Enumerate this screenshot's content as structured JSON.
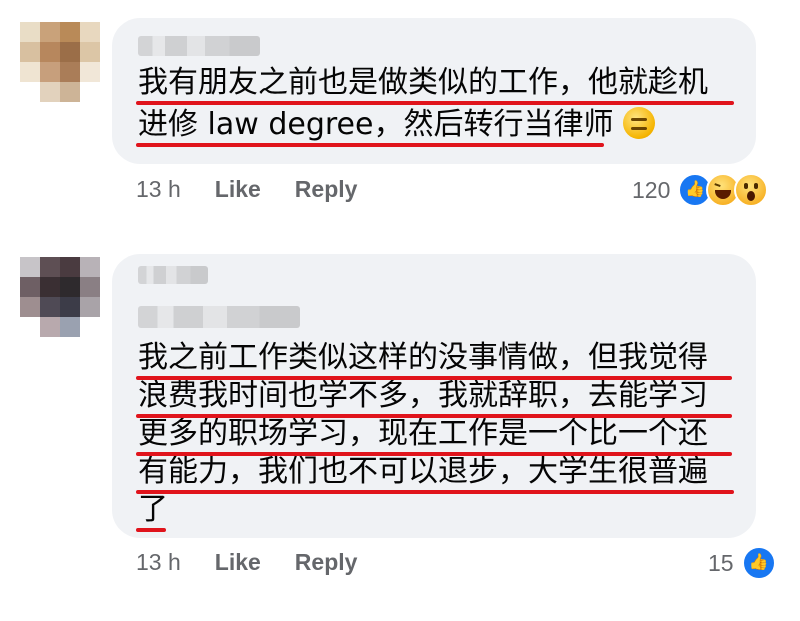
{
  "comments": [
    {
      "author": "",
      "lines": [
        "我有朋友之前也是做类似的工作，他就趁机",
        "进修 law degree，然后转行当律师"
      ],
      "trailing_emoji": "expressionless-face",
      "time": "13 h",
      "like_label": "Like",
      "reply_label": "Reply",
      "reaction_count": "120",
      "reactions": [
        "like",
        "haha",
        "wow"
      ]
    },
    {
      "author": "",
      "lines": [
        "我之前工作类似这样的没事情做，但我觉得",
        "浪费我时间也学不多，我就辞职，去能学习",
        "更多的职场学习，现在工作是一个比一个还",
        "有能力，我们也不可以退步，大学生很普遍",
        "了"
      ],
      "time": "13 h",
      "like_label": "Like",
      "reply_label": "Reply",
      "reaction_count": "15",
      "reactions": [
        "like"
      ]
    }
  ],
  "colors": {
    "bubble": "#f0f2f5",
    "underline": "#e0141c",
    "meta_text": "#65676b",
    "like_blue": "#1877f2"
  }
}
